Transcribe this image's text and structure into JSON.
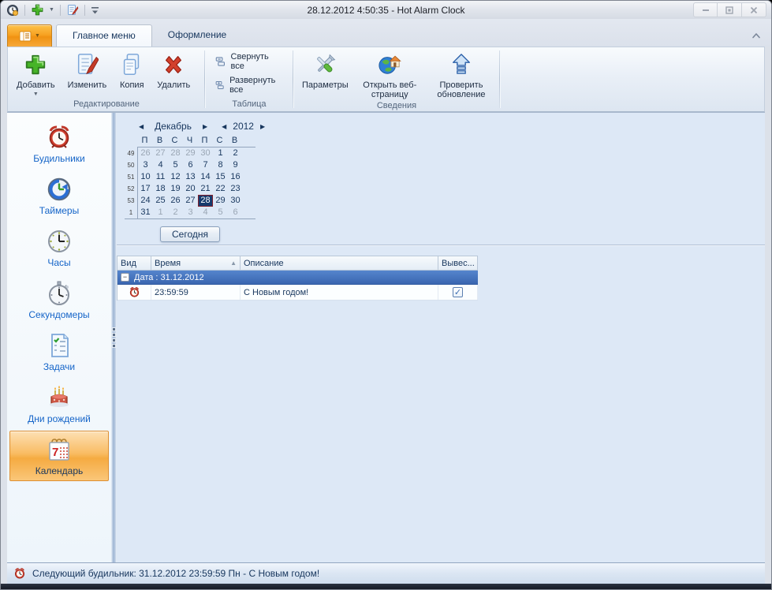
{
  "window": {
    "title": "28.12.2012 4:50:35 - Hot Alarm Clock",
    "controls": {
      "minimize": "minimize",
      "maximize": "maximize",
      "close": "close"
    }
  },
  "colors": {
    "accent_orange": "#f6a222",
    "selection_navy": "#173a6d",
    "selection_border_red": "#7d1f2d",
    "group_row_blue": "#3a66b0",
    "sidebar_link_blue": "#1464c8",
    "content_bg": "#dde8f6"
  },
  "tabs": {
    "items": [
      {
        "label": "Главное меню"
      },
      {
        "label": "Оформление"
      }
    ]
  },
  "ribbon": {
    "groups": [
      {
        "label": "Редактирование",
        "buttons": [
          {
            "label": "Добавить"
          },
          {
            "label": "Изменить"
          },
          {
            "label": "Копия"
          },
          {
            "label": "Удалить"
          }
        ]
      },
      {
        "label": "Таблица",
        "buttons": [
          {
            "label": "Свернуть все"
          },
          {
            "label": "Развернуть все"
          }
        ]
      },
      {
        "label": "Сведения",
        "buttons": [
          {
            "label": "Параметры"
          },
          {
            "label": "Открыть веб-страницу"
          },
          {
            "label": "Проверить обновление"
          }
        ]
      }
    ]
  },
  "sidebar": {
    "items": [
      {
        "label": "Будильники"
      },
      {
        "label": "Таймеры"
      },
      {
        "label": "Часы"
      },
      {
        "label": "Секундомеры"
      },
      {
        "label": "Задачи"
      },
      {
        "label": "Дни рождений"
      },
      {
        "label": "Календарь",
        "selected": true
      }
    ]
  },
  "calendar": {
    "month": "Декабрь",
    "year": "2012",
    "today_button": "Сегодня",
    "day_headers": [
      "П",
      "В",
      "С",
      "Ч",
      "П",
      "С",
      "В"
    ],
    "selected_date": "28.12.2012",
    "weeks": [
      {
        "num": "49",
        "days": [
          {
            "d": "26",
            "muted": true
          },
          {
            "d": "27",
            "muted": true
          },
          {
            "d": "28",
            "muted": true
          },
          {
            "d": "29",
            "muted": true
          },
          {
            "d": "30",
            "muted": true
          },
          {
            "d": "1"
          },
          {
            "d": "2"
          }
        ]
      },
      {
        "num": "50",
        "days": [
          {
            "d": "3"
          },
          {
            "d": "4"
          },
          {
            "d": "5"
          },
          {
            "d": "6"
          },
          {
            "d": "7"
          },
          {
            "d": "8"
          },
          {
            "d": "9"
          }
        ]
      },
      {
        "num": "51",
        "days": [
          {
            "d": "10"
          },
          {
            "d": "11"
          },
          {
            "d": "12"
          },
          {
            "d": "13"
          },
          {
            "d": "14"
          },
          {
            "d": "15"
          },
          {
            "d": "16"
          }
        ]
      },
      {
        "num": "52",
        "days": [
          {
            "d": "17"
          },
          {
            "d": "18"
          },
          {
            "d": "19"
          },
          {
            "d": "20"
          },
          {
            "d": "21"
          },
          {
            "d": "22"
          },
          {
            "d": "23"
          }
        ]
      },
      {
        "num": "53",
        "days": [
          {
            "d": "24"
          },
          {
            "d": "25"
          },
          {
            "d": "26"
          },
          {
            "d": "27"
          },
          {
            "d": "28",
            "selected": true
          },
          {
            "d": "29"
          },
          {
            "d": "30"
          }
        ]
      },
      {
        "num": "1",
        "days": [
          {
            "d": "31"
          },
          {
            "d": "1",
            "muted": true
          },
          {
            "d": "2",
            "muted": true
          },
          {
            "d": "3",
            "muted": true
          },
          {
            "d": "4",
            "muted": true
          },
          {
            "d": "5",
            "muted": true
          },
          {
            "d": "6",
            "muted": true
          }
        ]
      }
    ]
  },
  "table": {
    "columns": [
      "Вид",
      "Время",
      "Описание",
      "Вывес..."
    ],
    "sorted_column": "Время",
    "group_row": {
      "label": "Дата : 31.12.2012",
      "collapse_glyph": "−"
    },
    "rows": [
      {
        "time": "23:59:59",
        "description": "С Новым годом!",
        "checked": true
      }
    ]
  },
  "statusbar": {
    "text": "Следующий будильник: 31.12.2012 23:59:59 Пн - С Новым годом!"
  }
}
